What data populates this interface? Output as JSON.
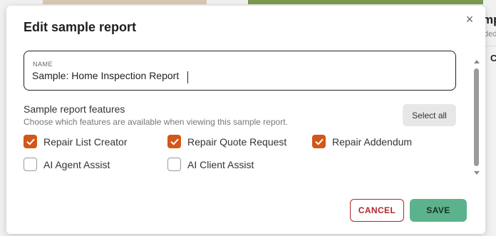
{
  "background": {
    "text_title_fragment": "mp",
    "text_sub_fragment": "ded",
    "text_item_fragment": "C"
  },
  "dialog": {
    "title": "Edit sample report",
    "close_glyph": "×",
    "name_field": {
      "label": "NAME",
      "value": "Sample: Home Inspection Report"
    },
    "features": {
      "heading": "Sample report features",
      "description": "Choose which features are available when viewing this sample report.",
      "select_all_label": "Select all",
      "items": [
        {
          "label": "Repair List Creator",
          "checked": true
        },
        {
          "label": "Repair Quote Request",
          "checked": true
        },
        {
          "label": "Repair Addendum",
          "checked": true
        },
        {
          "label": "AI Agent Assist",
          "checked": false
        },
        {
          "label": "AI Client Assist",
          "checked": false
        }
      ]
    },
    "buttons": {
      "cancel_label": "CANCEL",
      "save_label": "SAVE"
    }
  },
  "colors": {
    "checkbox_checked": "#d4561a",
    "cancel": "#b3262b",
    "save": "#5cb28c"
  }
}
